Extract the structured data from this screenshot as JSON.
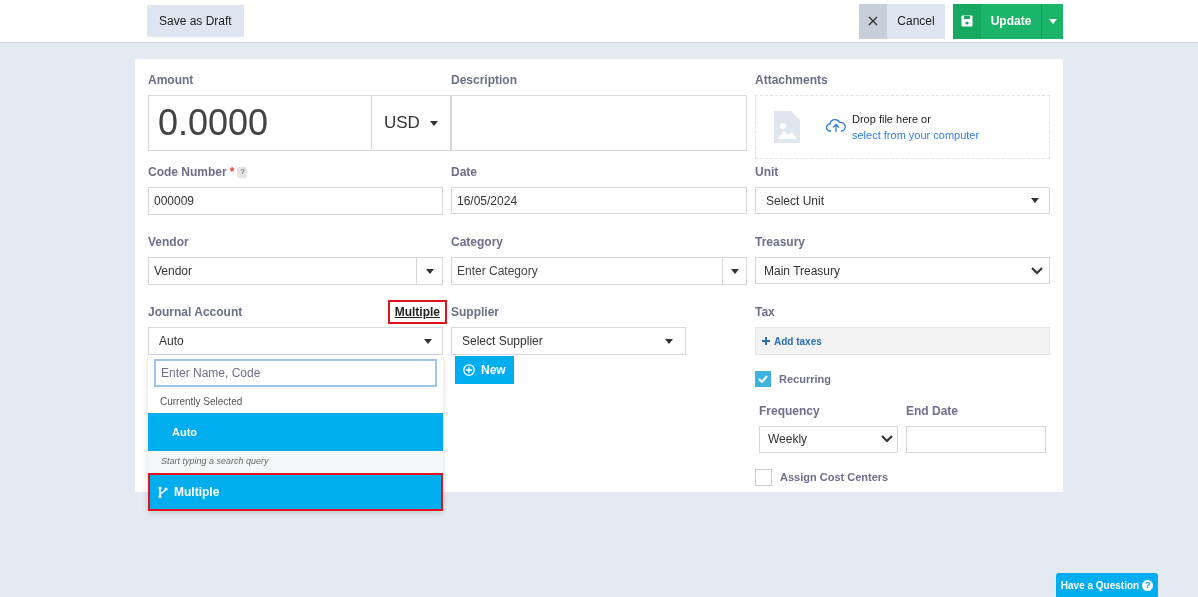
{
  "toolbar": {
    "save_draft": "Save as Draft",
    "cancel": "Cancel",
    "update": "Update"
  },
  "amount": {
    "label": "Amount",
    "value": "0.0000",
    "currency": "USD"
  },
  "description": {
    "label": "Description"
  },
  "attachments": {
    "label": "Attachments",
    "text": "Drop file here or",
    "link": "select from your computer"
  },
  "code_number": {
    "label": "Code Number",
    "required_mark": "*",
    "help": "?",
    "value": "000009"
  },
  "date": {
    "label": "Date",
    "value": "16/05/2024"
  },
  "unit": {
    "label": "Unit",
    "value": "Select Unit"
  },
  "vendor": {
    "label": "Vendor",
    "value": "Vendor"
  },
  "category": {
    "label": "Category",
    "placeholder": "Enter Category"
  },
  "treasury": {
    "label": "Treasury",
    "value": "Main Treasury"
  },
  "journal_account": {
    "label": "Journal Account",
    "multiple_link": "Multiple",
    "link_highlighted": true,
    "value": "Auto",
    "dropdown": {
      "search_placeholder": "Enter Name, Code",
      "section": "Currently Selected",
      "options": [
        {
          "label": "Auto",
          "selected": true
        }
      ],
      "hint": "Start typing a search query",
      "multiple_option": "Multiple",
      "option_highlighted": true
    }
  },
  "supplier": {
    "label": "Supplier",
    "value": "Select Supplier",
    "new_button": "New"
  },
  "tax": {
    "label": "Tax",
    "add": "Add taxes"
  },
  "recurring": {
    "label": "Recurring",
    "checked": true
  },
  "frequency": {
    "label": "Frequency",
    "value": "Weekly"
  },
  "end_date": {
    "label": "End Date"
  },
  "cost_centers": {
    "label": "Assign Cost Centers",
    "checked": false
  },
  "help_button": {
    "label": "Have a Question",
    "icon": "?"
  }
}
